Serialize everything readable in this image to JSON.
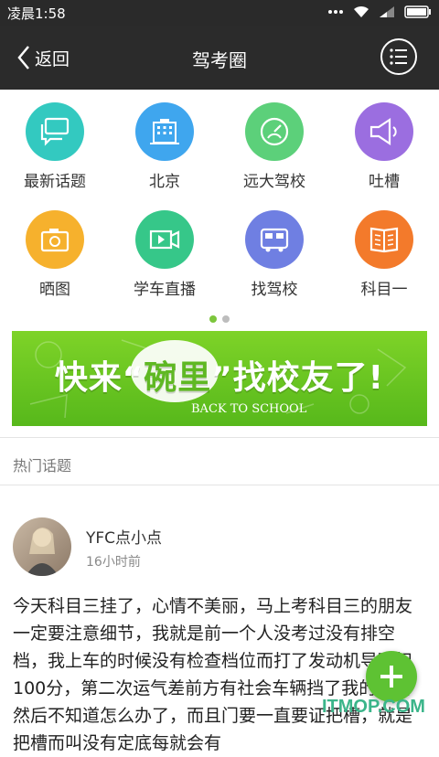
{
  "status": {
    "time": "凌晨1:58"
  },
  "nav": {
    "back_label": "返回",
    "title": "驾考圈"
  },
  "grid": [
    {
      "label": "最新话题",
      "icon": "chat-bubbles-icon",
      "color": "#33c9c0"
    },
    {
      "label": "北京",
      "icon": "building-icon",
      "color": "#3fa6ee"
    },
    {
      "label": "远大驾校",
      "icon": "speedometer-icon",
      "color": "#5cd07a"
    },
    {
      "label": "吐槽",
      "icon": "megaphone-icon",
      "color": "#9b6ee0"
    },
    {
      "label": "晒图",
      "icon": "camera-icon",
      "color": "#f6b12d"
    },
    {
      "label": "学车直播",
      "icon": "video-icon",
      "color": "#36c789"
    },
    {
      "label": "找驾校",
      "icon": "bus-icon",
      "color": "#6f7fe2"
    },
    {
      "label": "科目一",
      "icon": "book-icon",
      "color": "#f37a2b"
    }
  ],
  "pager": {
    "active": 1,
    "total": 2
  },
  "banner": {
    "pre": "快来",
    "quoted": "碗里",
    "post": "找校友了!",
    "sub": "BACK TO SCHOOL"
  },
  "hot": {
    "title": "热门话题"
  },
  "post": {
    "user": "YFC点小点",
    "time": "16小时前",
    "body": "今天科目三挂了，心情不美丽，马上考科目三的朋友一定要注意细节，我就是前一个人没考过没有排空档，我上车的时候没有检查档位而打了发动机导致扣100分，第二次运气差前方有社会车辆挡了我的道路然后不知道怎么办了，而且门要一直要证把槽，就是把槽而叫没有定底每就会有"
  },
  "watermark": "ITMOP.COM"
}
